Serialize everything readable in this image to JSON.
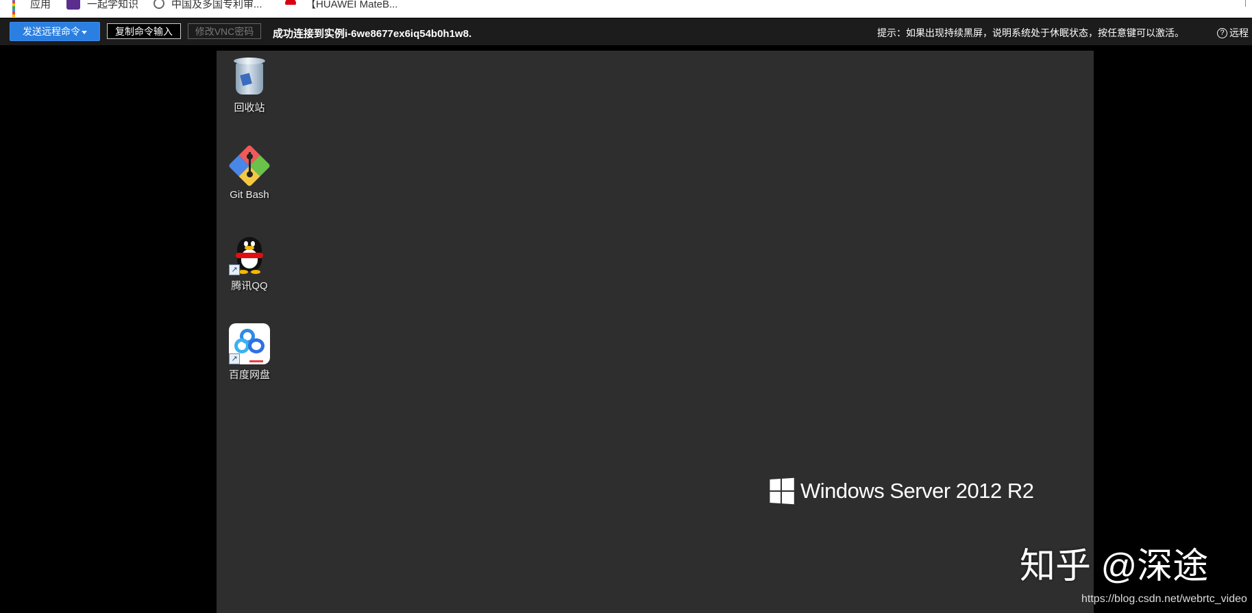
{
  "bookmarks_bar": {
    "items": [
      {
        "label": "应用",
        "icon": "apps-grid-icon"
      },
      {
        "label": "一起学知识",
        "icon": "book-icon"
      },
      {
        "label": "中国及多国专利审...",
        "icon": "globe-icon"
      },
      {
        "label": "【HUAWEI MateB...",
        "icon": "huawei-icon"
      }
    ]
  },
  "toolbar": {
    "send_command_label": "发送远程命令",
    "copy_input_label": "复制命令输入",
    "change_vnc_label": "修改VNC密码",
    "status_text": "成功连接到实例i-6we8677ex6iq54b0h1w8.",
    "hint_text": "提示：如果出现持续黑屏，说明系统处于休眠状态，按任意键可以激活。",
    "help_label": "远程",
    "accent_color": "#2b7fe0"
  },
  "desktop": {
    "icons": [
      {
        "label": "回收站",
        "icon": "recycle-bin-icon"
      },
      {
        "label": "Git Bash",
        "icon": "git-bash-icon"
      },
      {
        "label": "腾讯QQ",
        "icon": "qq-penguin-icon"
      },
      {
        "label": "百度网盘",
        "icon": "baidu-netdisk-icon"
      }
    ],
    "os_branding": "Windows Server 2012 R2",
    "background_color": "#2e2e2e"
  },
  "overlay": {
    "watermark": "知乎 @深途",
    "source_url": "https://blog.csdn.net/webrtc_video"
  }
}
